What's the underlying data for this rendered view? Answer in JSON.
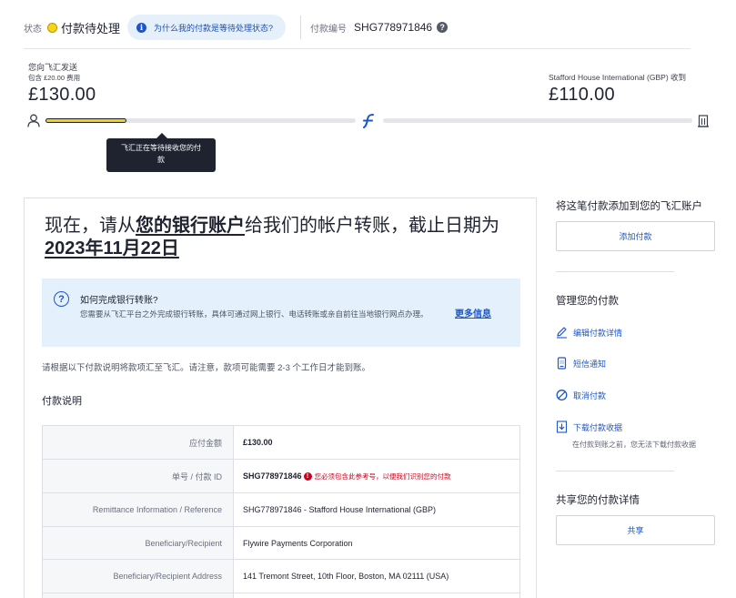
{
  "header": {
    "status_label": "状态",
    "status_value": "付款待处理",
    "why_link": "为什么我的付款是等待处理状态?",
    "payment_id_label": "付款编号",
    "payment_id": "SHG778971846"
  },
  "amounts": {
    "send_label": "您向飞汇发送",
    "fee_note": "包含 £20.00 费用",
    "send_amount": "£130.00",
    "receiver_label": "Stafford House International (GBP) 收到",
    "receive_amount": "£110.00"
  },
  "progress": {
    "fraction_first_leg": 0.26,
    "tooltip": "飞汇正在等待接收您的付款"
  },
  "main": {
    "heading_pre": "现在，请从",
    "heading_link": "您的银行账户",
    "heading_mid": "给我们的帐户转账，截止日期为 ",
    "heading_date": "2023年11月22日",
    "info_title": "如何完成银行转账?",
    "info_text": "您需要从飞汇平台之外完成银行转账，具体可通过网上银行、电话转账或亲自前往当地银行网点办理。",
    "info_more": "更多信息",
    "instruction": "请根据以下付款说明将款项汇至飞汇。请注意，款项可能需要 2-3 个工作日才能到账。",
    "section_title": "付款说明"
  },
  "details": {
    "rows": [
      {
        "key": "应付金额",
        "value": "£130.00"
      },
      {
        "key": "单号 / 付款 ID",
        "value": "SHG778971846",
        "warning": "您必须包含此参考号，以便我们识别您的付款"
      },
      {
        "key": "Remittance Information / Reference",
        "value": "SHG778971846 - Stafford House International (GBP)"
      },
      {
        "key": "Beneficiary/Recipient",
        "value": "Flywire Payments Corporation"
      },
      {
        "key": "Beneficiary/Recipient Address",
        "value": "141 Tremont Street, 10th Floor, Boston, MA 02111 (USA)"
      },
      {
        "key": "",
        "value": ""
      }
    ]
  },
  "sidebar": {
    "add_title": "将这笔付款添加到您的飞汇账户",
    "add_button": "添加付款",
    "manage_title": "管理您的付款",
    "items": [
      {
        "label": "编辑付款详情",
        "icon": "pencil-icon"
      },
      {
        "label": "短信通知",
        "icon": "phone-icon"
      },
      {
        "label": "取消付款",
        "icon": "cancel-icon"
      },
      {
        "label": "下载付款收据",
        "icon": "download-icon"
      }
    ],
    "download_note": "在付款到账之前，您无法下载付款收据",
    "share_title": "共享您的付款详情",
    "share_button": "共享"
  },
  "colors": {
    "accent": "#1d56c9",
    "status_yellow": "#f7d417",
    "warning_red": "#d0021b"
  }
}
